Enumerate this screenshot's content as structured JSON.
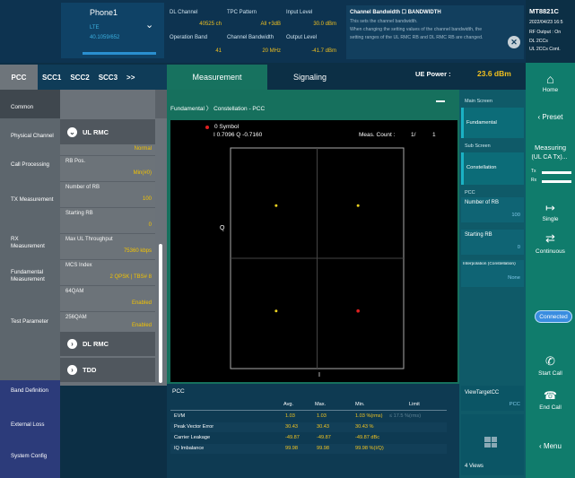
{
  "top": {
    "phone": {
      "name": "Phone1",
      "line1": "LTE",
      "line2": "40.1059/652"
    },
    "dl_channel": {
      "label": "DL Channel",
      "value": "40525 ch"
    },
    "operation_band": {
      "label": "Operation Band",
      "value": "41"
    },
    "tpc_pattern": {
      "label": "TPC Pattern",
      "value": "All +3dB"
    },
    "channel_bandwidth": {
      "label": "Channel Bandwidth",
      "value": "20 MHz"
    },
    "input_level": {
      "label": "Input Level",
      "value": "30.0 dBm"
    },
    "output_level": {
      "label": "Output Level",
      "value": "-41.7 dBm"
    },
    "help": {
      "title": "Channel Bandwidth ☐ BANDWIDTH",
      "text1": "This sets the channel bandwidth.",
      "text2": "When changing the setting values of the channel bandwidth, the",
      "text3": "setting ranges of the UL RMC RB and DL RMC RB are changed."
    }
  },
  "device": {
    "model": "MT8821C",
    "datetime": "2022/04/23 16:5",
    "rf_output": "RF Output : On",
    "dl_ccs": "DL 2CCs",
    "ul_ccs": "UL 2CCs Cont."
  },
  "subtabs": [
    "PCC",
    "SCC1",
    "SCC2",
    "SCC3",
    ">>"
  ],
  "nav": {
    "items": [
      "Common",
      "Physical Channel",
      "Call Processing",
      "TX Measurement",
      "RX Measurement",
      "Fundamental Measurement",
      "Test Parameter"
    ],
    "bottom": [
      "Band Definition",
      "External Loss",
      "System Config"
    ]
  },
  "panel": {
    "ul_rmc": "UL RMC",
    "ul_rmc_value": "Normal",
    "rb_pos": {
      "label": "RB Pos.",
      "value": "Min(#0)"
    },
    "num_rb": {
      "label": "Number of RB",
      "value": "100"
    },
    "start_rb": {
      "label": "Starting RB",
      "value": "0"
    },
    "max_ul": {
      "label": "Max UL Throughput",
      "value": "75360 kbps"
    },
    "mcs": {
      "label": "MCS Index",
      "value": "2  QPSK  |  TBS# 8"
    },
    "q64": {
      "label": "64QAM",
      "value": "Enabled"
    },
    "q256": {
      "label": "256QAM",
      "value": "Enabled"
    },
    "dl_rmc": "DL RMC",
    "tdd": "TDD"
  },
  "main": {
    "tab_measurement": "Measurement",
    "tab_signaling": "Signaling",
    "ue_power_label": "UE Power :",
    "ue_power_value": "23.6 dBm",
    "breadcrumb_a": "Fundamental",
    "breadcrumb_b": "Constellation - PCC",
    "plot": {
      "symbol": "0 Symbol",
      "iq": "I 0.7096 Q -0.7160",
      "meas_count_label": "Meas. Count :",
      "meas_count": "1/",
      "meas_total": "1",
      "q_label": "Q",
      "i_label": "I"
    }
  },
  "chart_data": {
    "type": "scatter",
    "title": "Constellation - PCC",
    "xlabel": "I",
    "ylabel": "Q",
    "series": [
      {
        "name": "",
        "points": [
          [
            -0.7096,
            0.716
          ],
          [
            0.7096,
            0.716
          ],
          [
            -0.7096,
            -0.716
          ],
          [
            0.7096,
            -0.716
          ]
        ]
      }
    ],
    "marker": [
      0.7096,
      -0.716
    ],
    "xlim": [
      -1.5,
      1.5
    ],
    "ylim": [
      -1.5,
      1.5
    ],
    "colors": {
      "points": "#e8d020",
      "marker": "#e02020"
    }
  },
  "table": {
    "section": "PCC",
    "headers": [
      "Avg.",
      "Max.",
      "Min.",
      "Limit"
    ],
    "rows": [
      {
        "name": "EVM",
        "avg": "1.03",
        "max": "1.03",
        "min": "1.03 %(rms)",
        "limit": "≤ 17.5 %(rms)"
      },
      {
        "name": "Peak Vector Error",
        "avg": "30.43",
        "max": "30.43",
        "min": "30.43 %",
        "limit": ""
      },
      {
        "name": "Carrier Leakage",
        "avg": "-49.87",
        "max": "-49.87",
        "min": "-49.87 dBc",
        "limit": ""
      },
      {
        "name": "IQ Imbalance",
        "avg": "99.98",
        "max": "99.98",
        "min": "99.98 %(I/Q)",
        "limit": ""
      }
    ]
  },
  "right": {
    "main_screen": "Main Screen",
    "fundamental": "Fundamental",
    "sub_screen": "Sub Screen",
    "constellation": "Constellation",
    "pcc": "PCC",
    "num_rb": {
      "label": "Number of RB",
      "value": "100"
    },
    "start_rb": {
      "label": "Starting RB",
      "value": "0"
    },
    "interp": {
      "label": "Interpolation (Constellation)",
      "value": "None"
    },
    "view_target": {
      "label": "ViewTargetCC",
      "value": "PCC"
    },
    "views": "4 Views"
  },
  "far": {
    "home": "Home",
    "preset": "Preset",
    "measuring": "Measuring",
    "measuring_sub": "(UL CA Tx)...",
    "tx": "Tx",
    "rx": "Rx",
    "single": "Single",
    "continuous": "Continuous",
    "connected": "Connected",
    "start_call": "Start Call",
    "end_call": "End Call",
    "menu": "Menu"
  },
  "colors": {
    "accent": "#f0c020",
    "main_bg": "#16705d",
    "connected": "#3a8de0"
  }
}
